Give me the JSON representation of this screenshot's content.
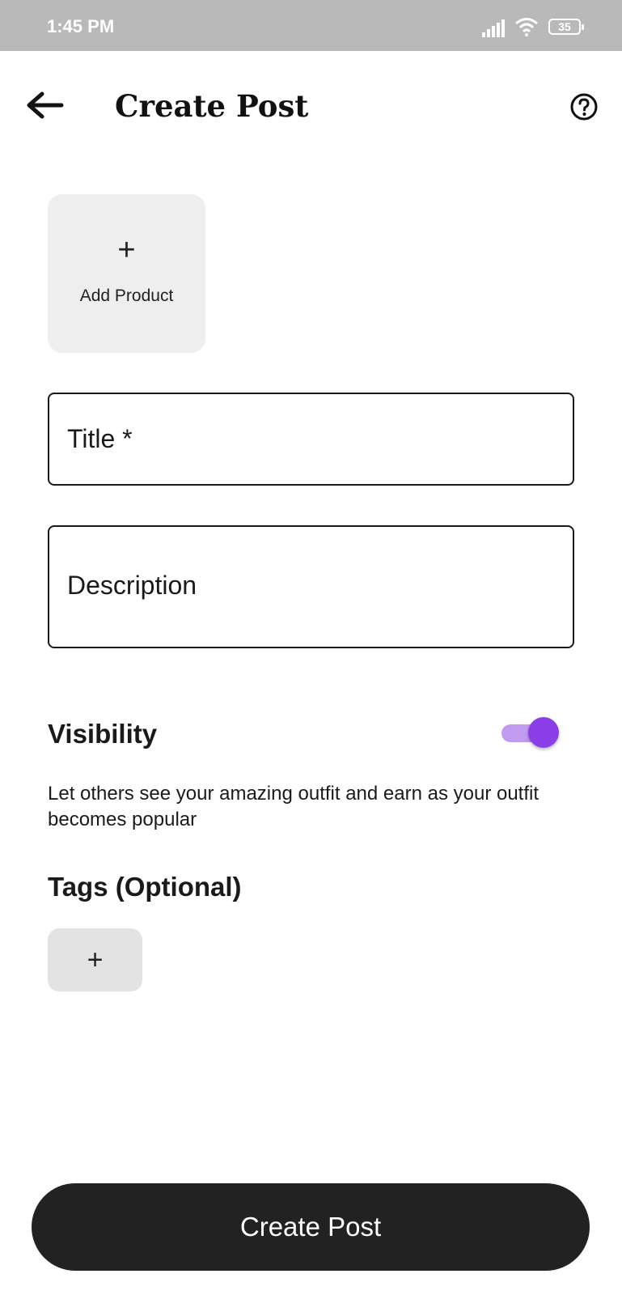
{
  "status_bar": {
    "time": "1:45 PM",
    "battery": "35",
    "icons": [
      "signal-icon",
      "wifi-icon",
      "battery-icon"
    ]
  },
  "header": {
    "title": "Create Post",
    "back_icon": "arrow-left-icon",
    "help_icon": "help-circle-icon"
  },
  "add_product": {
    "plus": "+",
    "label": "Add Product"
  },
  "form": {
    "title_placeholder": "Title *",
    "description_placeholder": "Description"
  },
  "visibility": {
    "heading": "Visibility",
    "enabled": true,
    "description": "Let others see your amazing outfit and earn as your outfit becomes popular"
  },
  "tags": {
    "heading": "Tags (Optional)",
    "add_label": "+"
  },
  "submit": {
    "label": "Create Post"
  },
  "colors": {
    "toggle_track": "#c29bf0",
    "toggle_thumb": "#8a3ee6",
    "button_bg": "#222222",
    "status_bar": "#b9b9b9"
  }
}
